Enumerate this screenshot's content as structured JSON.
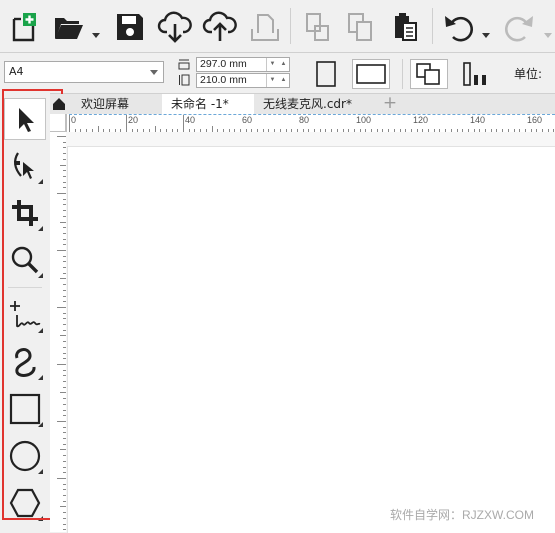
{
  "toolbar": {
    "items": [
      "new-document",
      "open",
      "save",
      "cloud-import",
      "cloud-export",
      "publish",
      "copy-properties",
      "paste-properties",
      "clipboard",
      "undo",
      "redo"
    ]
  },
  "property_bar": {
    "page_size": "A4",
    "width_value": "297.0 mm",
    "height_value": "210.0 mm",
    "unit_label": "单位:"
  },
  "tabs": {
    "items": [
      {
        "label": "欢迎屏幕"
      },
      {
        "label": "未命名 -1*"
      },
      {
        "label": "无线麦克风.cdr*"
      }
    ],
    "add_label": "+"
  },
  "ruler": {
    "labels": [
      "0",
      "20",
      "40",
      "60",
      "80",
      "100",
      "120",
      "140",
      "160"
    ]
  },
  "toolbox": {
    "tools": [
      "pick-tool",
      "shape-tool",
      "crop-tool",
      "zoom-tool",
      "freehand-tool",
      "artistic-media-tool",
      "rectangle-tool",
      "ellipse-tool",
      "polygon-tool"
    ]
  },
  "colors": {
    "highlight": "#e0342f",
    "toolbar_bg": "#f0f0f0",
    "new_doc_green": "#1aa34a",
    "ruler_line": "#6ba7d8"
  },
  "watermark": "软件自学网：RJZXW.COM"
}
